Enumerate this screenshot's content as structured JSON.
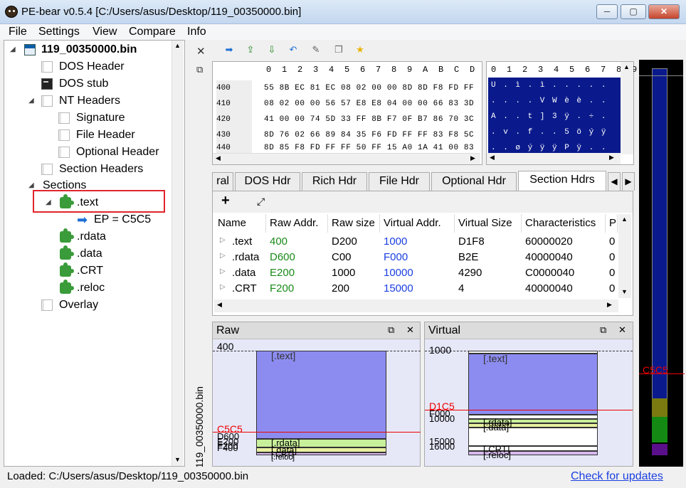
{
  "window": {
    "title": "PE-bear v0.5.4 [C:/Users/asus/Desktop/119_00350000.bin]",
    "min_glyph": "─",
    "max_glyph": "▢",
    "close_glyph": "✕"
  },
  "menu": [
    "File",
    "Settings",
    "View",
    "Compare",
    "Info"
  ],
  "tree": {
    "root": "119_00350000.bin",
    "dos_header": "DOS Header",
    "dos_stub": "DOS stub",
    "nt_headers": "NT Headers",
    "signature": "Signature",
    "file_header": "File Header",
    "optional_header": "Optional Header",
    "section_headers": "Section Headers",
    "sections": "Sections",
    "text": ".text",
    "ep": "EP = C5C5",
    "rdata": ".rdata",
    "data": ".data",
    "crt": ".CRT",
    "reloc": ".reloc",
    "overlay": "Overlay"
  },
  "vertical_label": "119_00350000.bin",
  "hex": {
    "columns": [
      "0",
      "1",
      "2",
      "3",
      "4",
      "5",
      "6",
      "7",
      "8",
      "9",
      "A",
      "B",
      "C",
      "D"
    ],
    "rows": [
      {
        "offset": "400",
        "bytes": "55 8B EC 81 EC 08 02 00 00 8D 8D F8 FD FF"
      },
      {
        "offset": "410",
        "bytes": "08 02 00 00 56 57 E8 E8 04 00 00 66 83 3D"
      },
      {
        "offset": "420",
        "bytes": "41 00 00 74 5D 33 FF 8B F7 0F B7 86 70 3C"
      },
      {
        "offset": "430",
        "bytes": "8D 76 02 66 89 84 35 F6 FD FF FF 83 F8 5C"
      },
      {
        "offset": "440",
        "bytes": "8D 85 F8 FD FF FF 50 FF 15 A0 1A 41 00 83"
      }
    ],
    "ascii_columns": [
      "0",
      "1",
      "2",
      "3",
      "4",
      "5",
      "6",
      "7",
      "8",
      "9"
    ],
    "ascii_rows": [
      "U . ì . ì . . . . .",
      ". . . . V W è è . .",
      "A . . t ] 3 ÿ . ÷ .",
      ". v . f . . 5 ö ý ÿ",
      ". . ø ý ÿ ÿ P ÿ . ."
    ]
  },
  "tabs": [
    "ral",
    "DOS Hdr",
    "Rich Hdr",
    "File Hdr",
    "Optional Hdr",
    "Section Hdrs"
  ],
  "tab_active": "Section Hdrs",
  "table": {
    "headers": [
      "Name",
      "Raw Addr.",
      "Raw size",
      "Virtual Addr.",
      "Virtual Size",
      "Characteristics",
      "P"
    ],
    "rows": [
      {
        "name": ".text",
        "raw_addr": "400",
        "raw_size": "D200",
        "virt_addr": "1000",
        "virt_size": "D1F8",
        "chars": "60000020",
        "p": "0"
      },
      {
        "name": ".rdata",
        "raw_addr": "D600",
        "raw_size": "C00",
        "virt_addr": "F000",
        "virt_size": "B2E",
        "chars": "40000040",
        "p": "0"
      },
      {
        "name": ".data",
        "raw_addr": "E200",
        "raw_size": "1000",
        "virt_addr": "10000",
        "virt_size": "4290",
        "chars": "C0000040",
        "p": "0"
      },
      {
        "name": ".CRT",
        "raw_addr": "F200",
        "raw_size": "200",
        "virt_addr": "15000",
        "virt_size": "4",
        "chars": "40000040",
        "p": "0"
      }
    ]
  },
  "raw": {
    "title": "Raw",
    "addr_400": "400",
    "ep": "C5C5",
    "d600": "D600",
    "e200": "E200",
    "f200": "F200",
    "f400": "F400",
    "sec_text": "[.text]",
    "sec_rdata": "[.rdata]",
    "sec_data": "[.data]",
    "sec_crt": "[.CRT]",
    "sec_reloc": "[.reloc]"
  },
  "virtual": {
    "title": "Virtual",
    "addr_1000": "1000",
    "ep": "D1C5",
    "f000": "F000",
    "a10000": "10000",
    "a15000": "15000",
    "a16000": "16000",
    "sec_text": "[.text]",
    "sec_rdata": "[.rdata]",
    "sec_data": "[.data]",
    "sec_crt": "[.CRT]",
    "sec_reloc": "[.reloc]"
  },
  "overview_ep": "C5C5",
  "status": {
    "loaded": "Loaded: C:/Users/asus/Desktop/119_00350000.bin",
    "updates": "Check for updates"
  },
  "colors": {
    "accent_blue": "#1a3fe0",
    "raw_addr_green": "#1a8a1a",
    "ascii_bg": "#0a1a8c",
    "text_section": "#8c8cf0",
    "rdata_section": "#c8f09a",
    "highlight_red": "#e0252a"
  }
}
